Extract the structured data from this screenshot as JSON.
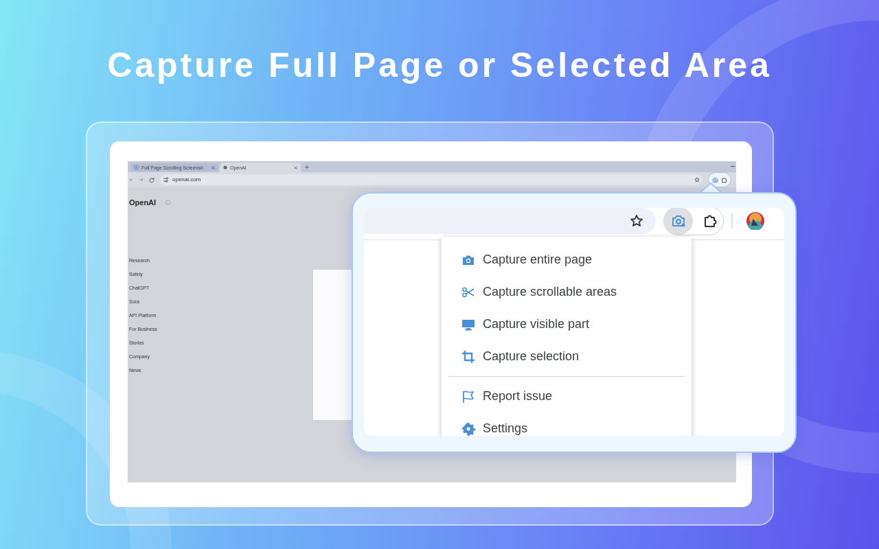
{
  "headline": "Capture Full Page or Selected Area",
  "browser": {
    "tabs": [
      {
        "title": "Full Page Scrolling Screensh",
        "kind": "extension",
        "selected": false
      },
      {
        "title": "OpenAI",
        "kind": "site",
        "selected": true
      }
    ],
    "new_tab": "+",
    "address": "openai.com",
    "extensions": [
      {
        "kind": "capture",
        "selected": true
      },
      {
        "kind": "puzzle",
        "selected": false
      }
    ],
    "page": {
      "logo": "OpenAI",
      "nav": [
        "Research",
        "Safety",
        "ChatGPT",
        "Sora",
        "API Platform",
        "For Business",
        "Stories",
        "Company",
        "News"
      ]
    }
  },
  "popup": {
    "extensions": [
      {
        "kind": "capture",
        "selected": true
      },
      {
        "kind": "puzzle",
        "selected": false
      }
    ],
    "menu": [
      [
        {
          "label": "Capture entire page",
          "kind": "camera"
        },
        {
          "label": "Capture scrollable areas",
          "kind": "scissors"
        },
        {
          "label": "Capture visible part",
          "kind": "monitor"
        },
        {
          "label": "Capture selection",
          "kind": "crop"
        }
      ],
      [
        {
          "label": "Report issue",
          "kind": "flag"
        },
        {
          "label": "Settings",
          "kind": "gear"
        }
      ]
    ]
  }
}
